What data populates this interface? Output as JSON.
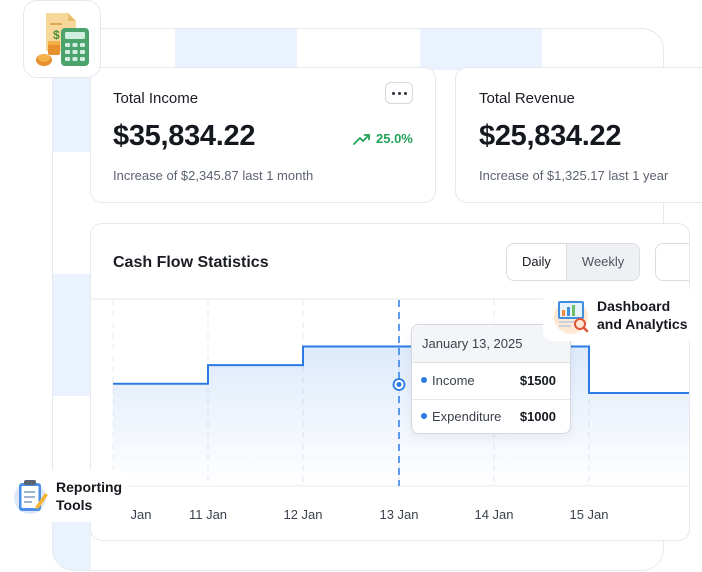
{
  "income_card": {
    "title": "Total Income",
    "value": "$35,834.22",
    "trend": "25.0%",
    "note": "Increase of $2,345.87 last 1 month"
  },
  "revenue_card": {
    "title": "Total Revenue",
    "value": "$25,834.22",
    "note": "Increase of $1,325.17 last 1 year"
  },
  "cash_flow": {
    "title": "Cash Flow Statistics",
    "tabs": {
      "daily": "Daily",
      "weekly": "Weekly"
    },
    "tooltip": {
      "date": "January 13, 2025",
      "rows": [
        {
          "label": "Income",
          "value": "$1500"
        },
        {
          "label": "Expenditure",
          "value": "$1000"
        }
      ]
    }
  },
  "badges": {
    "dashboard_line1": "Dashboard",
    "dashboard_line2": "and Analytics",
    "reporting_line1": "Reporting",
    "reporting_line2": "Tools"
  },
  "colors": {
    "accent": "#2c7be5",
    "positive": "#21a35a",
    "checker": "#eaf2fe"
  },
  "icons": [
    "calculator-money-icon",
    "more-icon",
    "trend-up-icon",
    "dashboard-analytics-icon",
    "reporting-clipboard-icon"
  ],
  "chart_data": {
    "type": "line",
    "x": [
      "Jan",
      "11 Jan",
      "12 Jan",
      "13 Jan",
      "14 Jan",
      "15 Jan"
    ],
    "values": [
      1100,
      1300,
      1500,
      1500,
      1500,
      1000
    ],
    "ylim": [
      0,
      2000
    ],
    "grid": "vertical dashed",
    "highlight": "13 Jan"
  }
}
